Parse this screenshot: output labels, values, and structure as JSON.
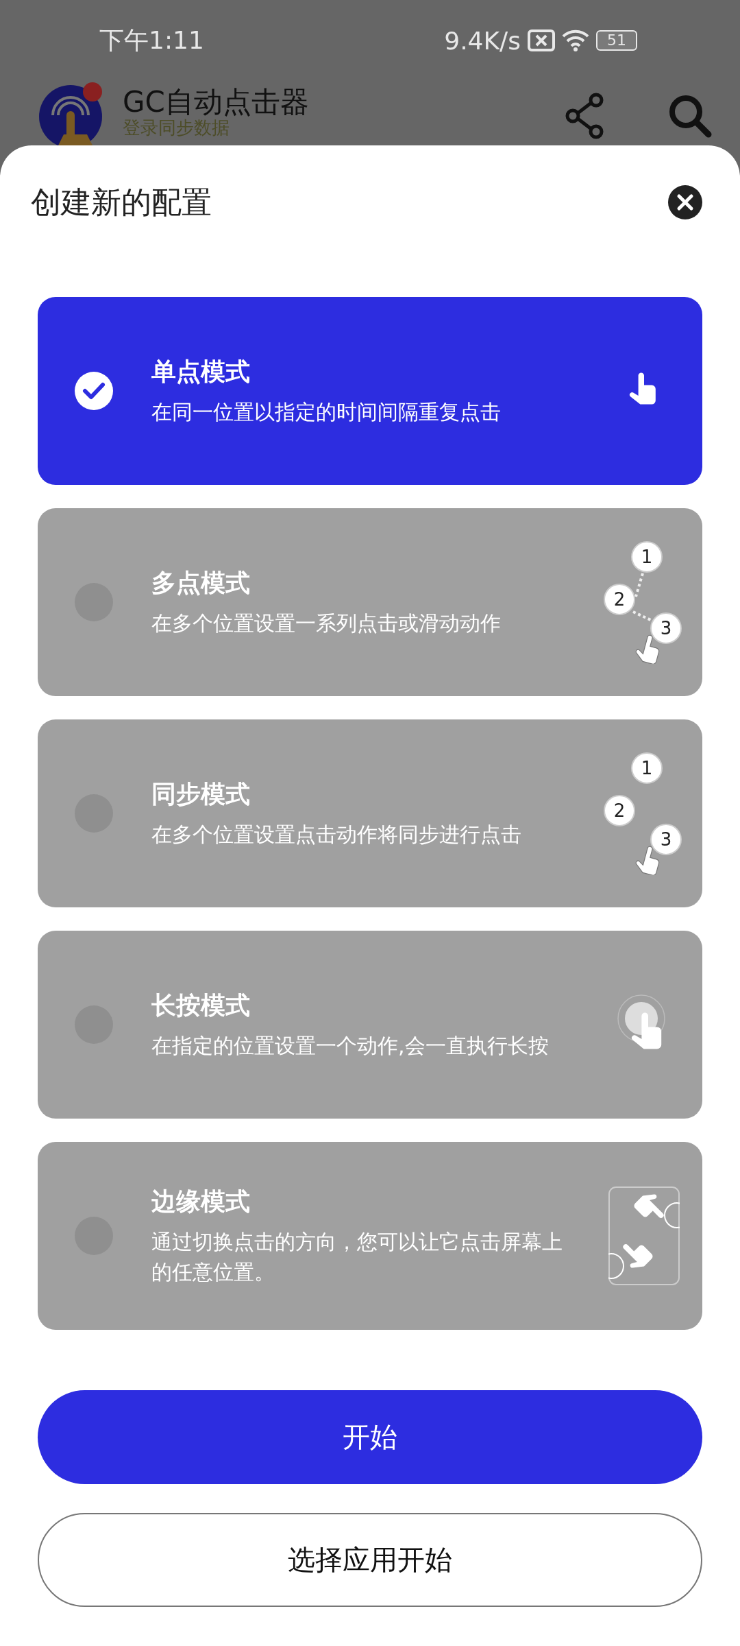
{
  "status_bar": {
    "time": "下午1:11",
    "speed": "9.4K/s",
    "battery": "51"
  },
  "app_bar": {
    "title": "GC自动点击器",
    "subtitle": "登录同步数据"
  },
  "sheet": {
    "title": "创建新的配置",
    "modes": [
      {
        "title": "单点模式",
        "description": "在同一位置以指定的时间间隔重复点击",
        "selected": true,
        "kind": "tap"
      },
      {
        "title": "多点模式",
        "description": "在多个位置设置一系列点击或滑动动作",
        "selected": false,
        "kind": "multi",
        "badges": [
          "1",
          "2",
          "3"
        ]
      },
      {
        "title": "同步模式",
        "description": "在多个位置设置点击动作将同步进行点击",
        "selected": false,
        "kind": "sync",
        "badges": [
          "1",
          "2",
          "3"
        ]
      },
      {
        "title": "长按模式",
        "description": "在指定的位置设置一个动作,会一直执行长按",
        "selected": false,
        "kind": "longpress"
      },
      {
        "title": "边缘模式",
        "description": "通过切换点击的方向，您可以让它点击屏幕上的任意位置。",
        "selected": false,
        "kind": "edge"
      }
    ],
    "buttons": [
      {
        "label": "开始",
        "kind": "primary"
      },
      {
        "label": "选择应用开始",
        "kind": "outline"
      }
    ]
  }
}
